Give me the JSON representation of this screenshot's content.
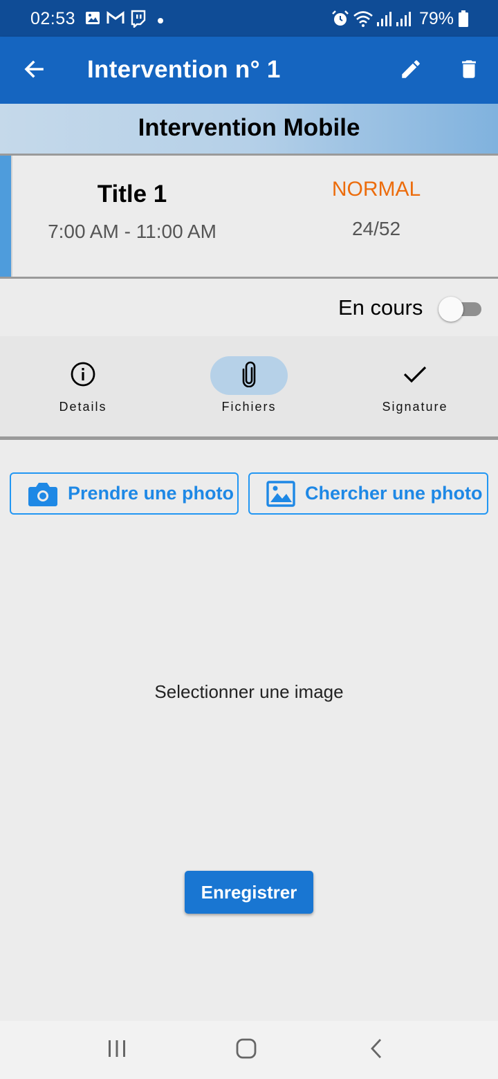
{
  "status_bar": {
    "time": "02:53",
    "battery": "79%",
    "icons": [
      "gallery-icon",
      "gmail-icon",
      "twitch-icon",
      "dot-icon",
      "alarm-icon",
      "wifi-icon",
      "signal-icon",
      "signal-icon",
      "battery-icon"
    ]
  },
  "app_bar": {
    "title": "Intervention n° 1",
    "back_icon": "arrow-left-icon",
    "edit_icon": "pencil-icon",
    "delete_icon": "trash-icon"
  },
  "subheader": {
    "title": "Intervention Mobile"
  },
  "card": {
    "title": "Title 1",
    "time_range": "7:00 AM - 11:00 AM",
    "priority": "NORMAL",
    "count": "24/52"
  },
  "status_toggle": {
    "label": "En cours",
    "checked": false
  },
  "tabs": [
    {
      "label": "Details",
      "icon": "info-icon",
      "active": false
    },
    {
      "label": "Fichiers",
      "icon": "paperclip-icon",
      "active": true
    },
    {
      "label": "Signature",
      "icon": "checkmark-icon",
      "active": false
    }
  ],
  "actions": {
    "take_photo": "Prendre une photo",
    "find_photo": "Chercher une photo"
  },
  "placeholder": "Selectionner une image",
  "save_button": "Enregistrer",
  "colors": {
    "status_bar": "#0f4c96",
    "app_bar": "#1565c0",
    "accent": "#2196f3",
    "priority": "#ec6c0c",
    "save": "#1976d2",
    "active_tab": "#b6d1e8"
  }
}
